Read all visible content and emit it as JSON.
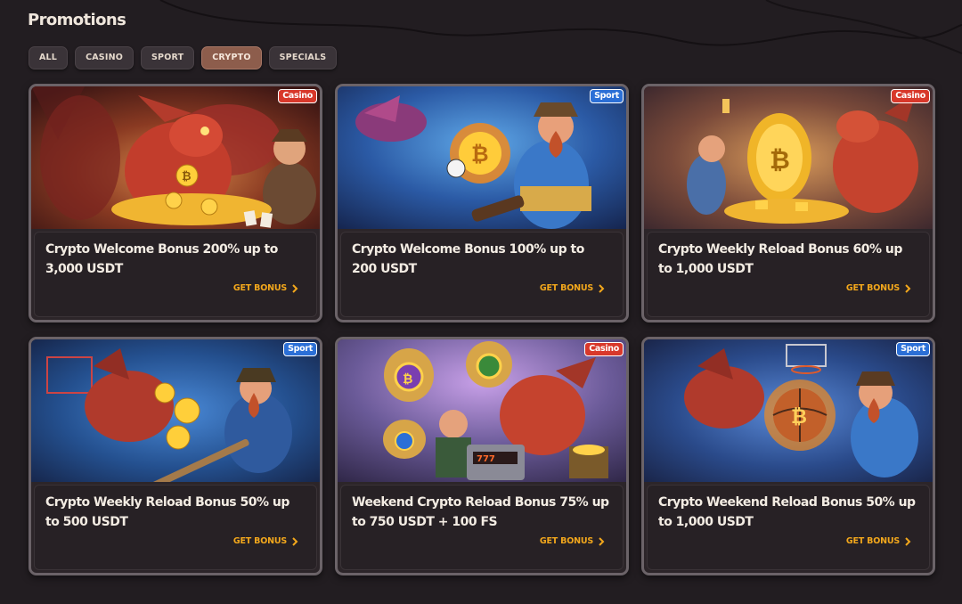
{
  "page": {
    "title": "Promotions"
  },
  "filters": [
    {
      "label": "ALL",
      "active": false
    },
    {
      "label": "CASINO",
      "active": false
    },
    {
      "label": "SPORT",
      "active": false
    },
    {
      "label": "CRYPTO",
      "active": true
    },
    {
      "label": "SPECIALS",
      "active": false
    }
  ],
  "colors": {
    "background": "#221d21",
    "accent": "#f2a71c",
    "active_filter": "#8d5d4c",
    "casino_tag": "#d8382b",
    "sport_tag": "#2b6fd6"
  },
  "cta_label": "GET BONUS",
  "promotions": [
    {
      "title": "Crypto Welcome Bonus 200% up to 3,000 USDT",
      "tag": "Casino",
      "art": "dragon-hoarding-gold-coins"
    },
    {
      "title": "Crypto Welcome Bonus 100% up to 200 USDT",
      "tag": "Sport",
      "art": "dwarf-kicking-flaming-bitcoin"
    },
    {
      "title": "Crypto Weekly Reload Bonus 60% up to 1,000 USDT",
      "tag": "Casino",
      "art": "golden-bitcoin-egg"
    },
    {
      "title": "Crypto Weekly Reload Bonus 50% up to 500 USDT",
      "tag": "Sport",
      "art": "hockey-dwarf-with-coins"
    },
    {
      "title": "Weekend Crypto Reload Bonus 75% up to 750 USDT + 100 FS",
      "tag": "Casino",
      "art": "slot-machine-with-coin-bags"
    },
    {
      "title": "Crypto Weekend Reload Bonus 50% up to 1,000 USDT",
      "tag": "Sport",
      "art": "basketball-dwarf-with-bitcoin"
    }
  ]
}
